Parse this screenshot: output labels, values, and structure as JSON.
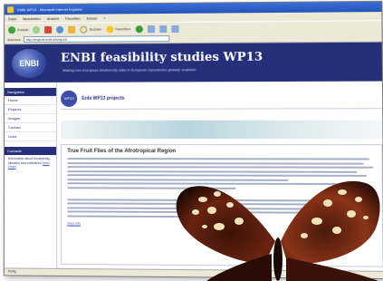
{
  "window": {
    "title": "ENBI WP13 - Microsoft Internet Explorer"
  },
  "menubar": {
    "items": [
      "Datei",
      "Bearbeiten",
      "Ansicht",
      "Favoriten",
      "Extras",
      "?"
    ]
  },
  "toolbar": {
    "back_label": "Zurück",
    "search_label": "Suchen",
    "favorites_label": "Favoriten"
  },
  "addressbar": {
    "label": "Adresse",
    "url": "http://projects.enbi.info/wp13/"
  },
  "site": {
    "logo_text": "ENBI",
    "title": "ENBI feasibility studies WP13",
    "subtitle": "Making non-European biodiversity data in European repositories globally available"
  },
  "leftnav": {
    "heading": "Navigation",
    "items": [
      "Home",
      "Projects",
      "Images",
      "Contact",
      "Links"
    ],
    "box_heading": "Contacts",
    "box_text": "Information about biodiversity, climates and collections",
    "box_link": "send email"
  },
  "section": {
    "logo_text": "WP13",
    "title": "Enbi WP13 projects"
  },
  "article": {
    "title": "True Fruit Flies of the Afrotropical Region",
    "more_link": "more info"
  },
  "statusbar": {
    "text": "Fertig"
  }
}
